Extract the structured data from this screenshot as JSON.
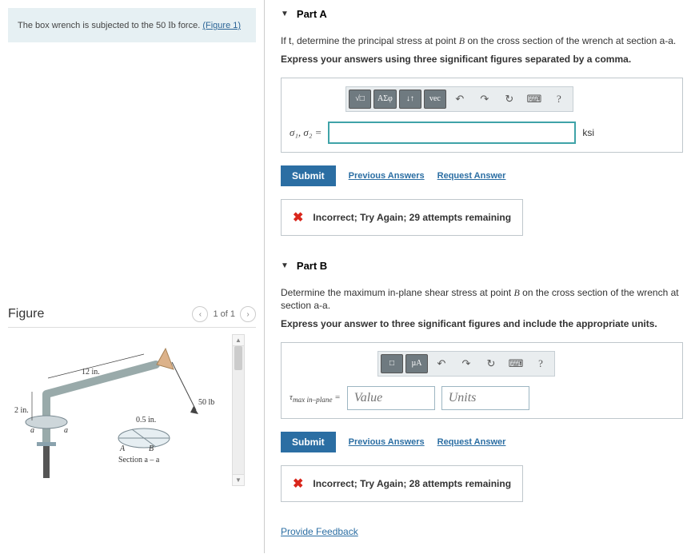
{
  "problem": {
    "text_prefix": "The box wrench is subjected to the ",
    "force_value": "50",
    "force_unit": "lb",
    "text_suffix": " force.",
    "figure_link": "(Figure 1)"
  },
  "figure": {
    "title": "Figure",
    "nav_label": "1 of 1",
    "labels": {
      "h_dim": "12 in.",
      "v_dim": "2 in.",
      "force": "50 lb",
      "radius": "0.5 in.",
      "a_left": "a",
      "a_right": "a",
      "A": "A",
      "B": "B",
      "section": "Section a – a"
    }
  },
  "partA": {
    "title": "Part A",
    "prompt_prefix": "If t, determine the principal stress at point ",
    "prompt_var": "B",
    "prompt_suffix": " on the cross section of the wrench at section a-a.",
    "instruction": "Express your answers using three significant figures separated by a comma.",
    "toolbar": {
      "templates": "√□",
      "greek": "ΑΣφ",
      "subsup": "↓↑",
      "vec": "vec",
      "undo": "↶",
      "redo": "↷",
      "reset": "↻",
      "keyboard": "⌨",
      "help": "?"
    },
    "var_label": "σ₁, σ₂ =",
    "unit": "ksi",
    "submit": "Submit",
    "prev_answers": "Previous Answers",
    "request_answer": "Request Answer",
    "feedback": "Incorrect; Try Again; 29 attempts remaining"
  },
  "partB": {
    "title": "Part B",
    "prompt_prefix": "Determine the maximum in-plane shear stress at point ",
    "prompt_var": "B",
    "prompt_suffix": " on the cross section of the wrench at section a-a.",
    "instruction": "Express your answer to three significant figures and include the appropriate units.",
    "toolbar": {
      "templates": "□",
      "units": "µA",
      "undo": "↶",
      "redo": "↷",
      "reset": "↻",
      "keyboard": "⌨",
      "help": "?"
    },
    "var_label_html": "τmax in–plane =",
    "value_placeholder": "Value",
    "units_placeholder": "Units",
    "submit": "Submit",
    "prev_answers": "Previous Answers",
    "request_answer": "Request Answer",
    "feedback": "Incorrect; Try Again; 28 attempts remaining"
  },
  "footer": {
    "provide_feedback": "Provide Feedback"
  }
}
